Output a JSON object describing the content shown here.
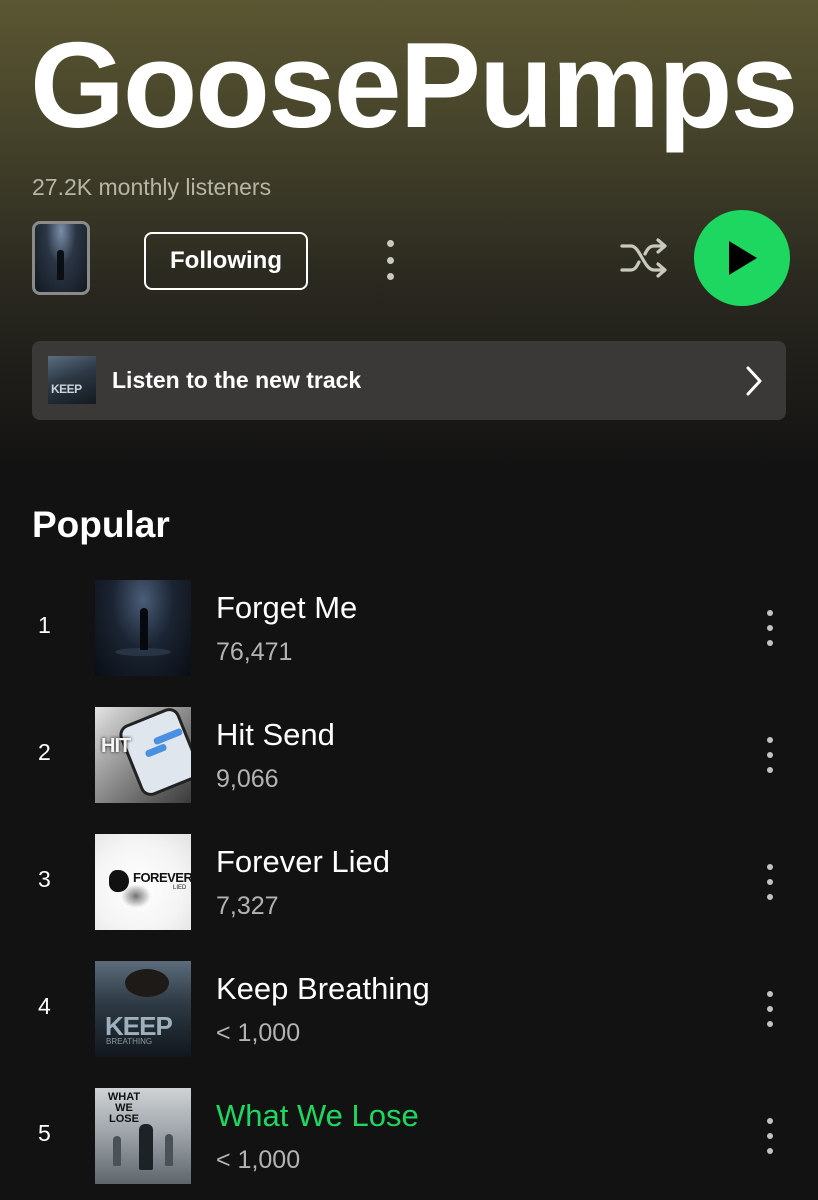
{
  "artist": {
    "name": "GoosePumps",
    "monthly_listeners": "27.2K monthly listeners"
  },
  "controls": {
    "follow_label": "Following",
    "more_icon": "more-vertical-icon",
    "shuffle_icon": "shuffle-icon",
    "play_icon": "play-icon"
  },
  "banner": {
    "thumb_text": "KEEP",
    "label": "Listen to the new track",
    "chevron_icon": "chevron-right-icon"
  },
  "popular": {
    "title": "Popular",
    "tracks": [
      {
        "num": "1",
        "title": "Forget Me",
        "plays": "76,471",
        "playing": false
      },
      {
        "num": "2",
        "title": "Hit Send",
        "plays": "9,066",
        "playing": false,
        "art_text": "HIT"
      },
      {
        "num": "3",
        "title": "Forever Lied",
        "plays": "7,327",
        "playing": false,
        "art_text": "FOREVER",
        "art_sub": "LIED"
      },
      {
        "num": "4",
        "title": "Keep Breathing",
        "plays": "< 1,000",
        "playing": false,
        "art_text": "KEEP",
        "art_sub": "BREATHING"
      },
      {
        "num": "5",
        "title": "What We Lose",
        "plays": "< 1,000",
        "playing": true,
        "art_text": "WHAT WE LOSE"
      }
    ]
  },
  "colors": {
    "accent": "#1ed760",
    "background": "#121212",
    "hero_top": "#5b5733",
    "banner_bg": "#3a3937",
    "secondary_text": "#b3b3b3"
  }
}
